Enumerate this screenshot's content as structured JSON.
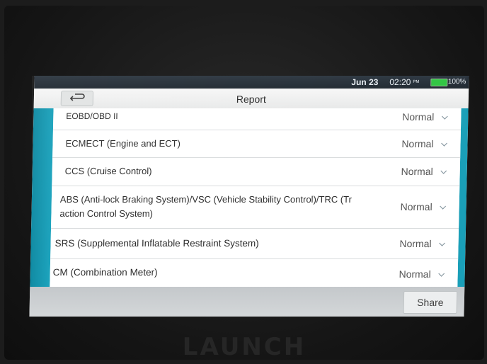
{
  "status": {
    "date": "Jun 23",
    "time": "02:20",
    "ampm": "PM",
    "battery": "100%",
    "battery_level": 1.0
  },
  "header": {
    "title": "Report",
    "back_icon": "back-arrow-icon"
  },
  "rows": [
    {
      "label": "EOBD/OBD II",
      "status": "Normal"
    },
    {
      "label": "ECMECT (Engine and ECT)",
      "status": "Normal"
    },
    {
      "label": "CCS (Cruise Control)",
      "status": "Normal"
    },
    {
      "label": "ABS (Anti-lock Braking System)/VSC (Vehicle Stability Control)/TRC (Tr",
      "label2": "action Control System)",
      "status": "Normal"
    },
    {
      "label": "SRS (Supplemental Inflatable Restraint System)",
      "status": "Normal"
    },
    {
      "label": "CM (Combination Meter)",
      "status": "Normal"
    }
  ],
  "footer": {
    "share_label": "Share"
  },
  "device": {
    "brand": "LAUNCH"
  },
  "colors": {
    "accent": "#1a9fb8",
    "battery": "#2fc542",
    "statusbar": "#1f2830"
  }
}
